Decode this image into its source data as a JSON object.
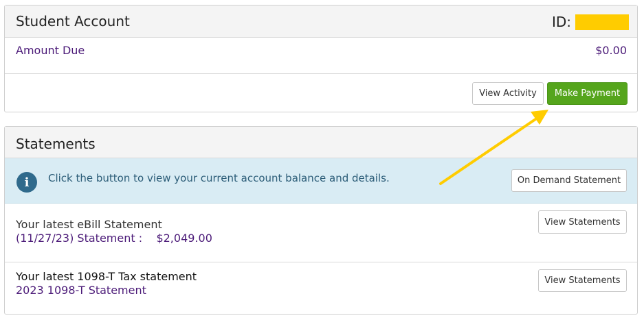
{
  "account": {
    "title": "Student Account",
    "id_label": "ID:",
    "amount_label": "Amount Due",
    "amount_value": "$0.00",
    "view_activity_label": "View Activity",
    "make_payment_label": "Make Payment"
  },
  "statements": {
    "title": "Statements",
    "info_text": "Click the button to view your current account balance and details.",
    "on_demand_label": "On Demand Statement",
    "ebill": {
      "title": "Your latest eBill Statement",
      "subtitle": "(11/27/23) Statement :    $2,049.00",
      "button_label": "View Statements"
    },
    "tax": {
      "title": "Your latest 1098-T Tax statement",
      "subtitle": "2023 1098-T Statement",
      "button_label": "View Statements"
    }
  },
  "colors": {
    "accent_purple": "#4b1a78",
    "payment_green": "#55a51c",
    "info_background": "#d9ecf4",
    "redaction_yellow": "#ffcc00",
    "annotation_arrow": "#ffcc00"
  },
  "icons": {
    "info": "info-icon",
    "annotation": "arrow-annotation-icon"
  }
}
